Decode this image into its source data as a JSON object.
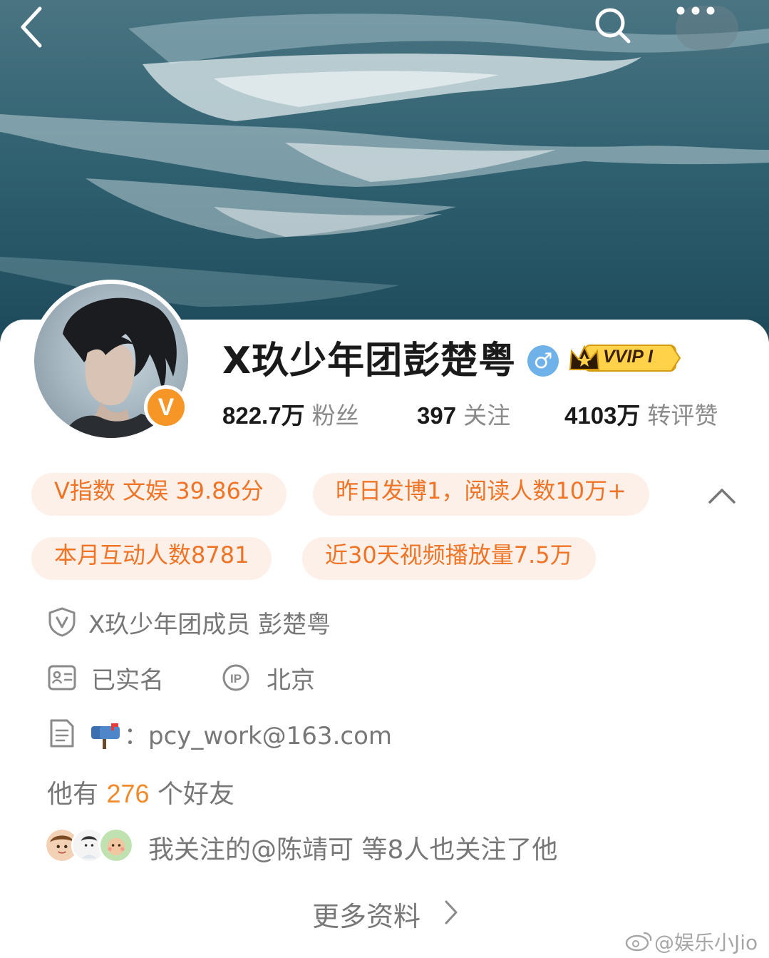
{
  "profile": {
    "name": "X玖少年团彭楚粤",
    "gender_symbol": "♂",
    "verified_badge": "V",
    "vip_label": "VVIP I",
    "stats": [
      {
        "value": "822.7万",
        "label": "粉丝"
      },
      {
        "value": "397",
        "label": "关注"
      },
      {
        "value": "4103万",
        "label": "转评赞"
      }
    ]
  },
  "tags": [
    "V指数 文娱 39.86分",
    "昨日发博1，阅读人数10万+",
    "本月互动人数8781",
    "近30天视频播放量7.5万"
  ],
  "info": {
    "certification": "X玖少年团成员 彭楚粤",
    "real_name": "已实名",
    "ip_location": "北京",
    "contact": "：pcy_work@163.com"
  },
  "friends": {
    "prefix": "他有",
    "count": "276",
    "suffix": "个好友"
  },
  "mutual_follow": "我关注的@陈靖可 等8人也关注了他",
  "more_info": "更多资料",
  "watermark": "@娱乐小Jio",
  "colors": {
    "accent_orange": "#f07426",
    "tag_bg": "#fdf0e8",
    "gender_blue": "#6fb2ea",
    "badge_orange": "#f59626"
  },
  "icons": [
    "back-icon",
    "search-icon",
    "more-icon",
    "shield-v-icon",
    "id-card-icon",
    "ip-icon",
    "document-icon",
    "mailbox-icon",
    "chevron-up-icon",
    "chevron-right-icon",
    "weibo-icon"
  ]
}
